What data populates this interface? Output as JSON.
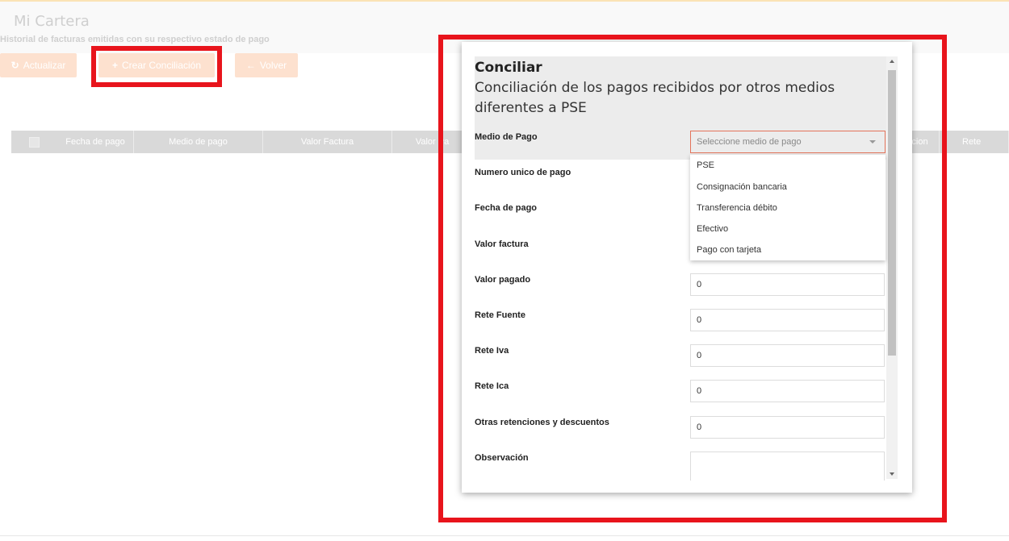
{
  "page": {
    "title": "Mi Cartera",
    "subtitle": "Historial de facturas emitidas con su respectivo estado de pago"
  },
  "toolbar": {
    "refresh_label": "Actualizar",
    "create_label": "Crear Conciliación",
    "back_label": "Volver"
  },
  "table": {
    "headers": [
      "Fecha de pago",
      "Medio de pago",
      "Valor Factura",
      "Valor Pa",
      "cion",
      "Rete Fuente"
    ]
  },
  "modal": {
    "title": "Conciliar",
    "subtitle": "Conciliación de los pagos recibidos por otros medios diferentes a PSE",
    "fields": {
      "medio_pago": {
        "label": "Medio de Pago",
        "placeholder": "Seleccione medio de pago"
      },
      "numero_unico": {
        "label": "Numero unico de pago"
      },
      "fecha_pago": {
        "label": "Fecha de pago"
      },
      "valor_factura": {
        "label": "Valor factura"
      },
      "valor_pagado": {
        "label": "Valor pagado",
        "value": "0"
      },
      "rete_fuente": {
        "label": "Rete Fuente",
        "value": "0"
      },
      "rete_iva": {
        "label": "Rete Iva",
        "value": "0"
      },
      "rete_ica": {
        "label": "Rete Ica",
        "value": "0"
      },
      "otras_retenciones": {
        "label": "Otras retenciones y descuentos",
        "value": "0"
      },
      "observacion": {
        "label": "Observación"
      }
    },
    "dropdown_options": [
      "PSE",
      "Consignación bancaria",
      "Transferencia débito",
      "Efectivo",
      "Pago con tarjeta"
    ]
  },
  "colors": {
    "highlight": "#e8141c",
    "button_bg": "#fde1cf",
    "select_border": "#e3735a"
  },
  "icons": {
    "refresh": "refresh-icon",
    "create": "plus-icon",
    "back": "back-arrow-icon"
  }
}
